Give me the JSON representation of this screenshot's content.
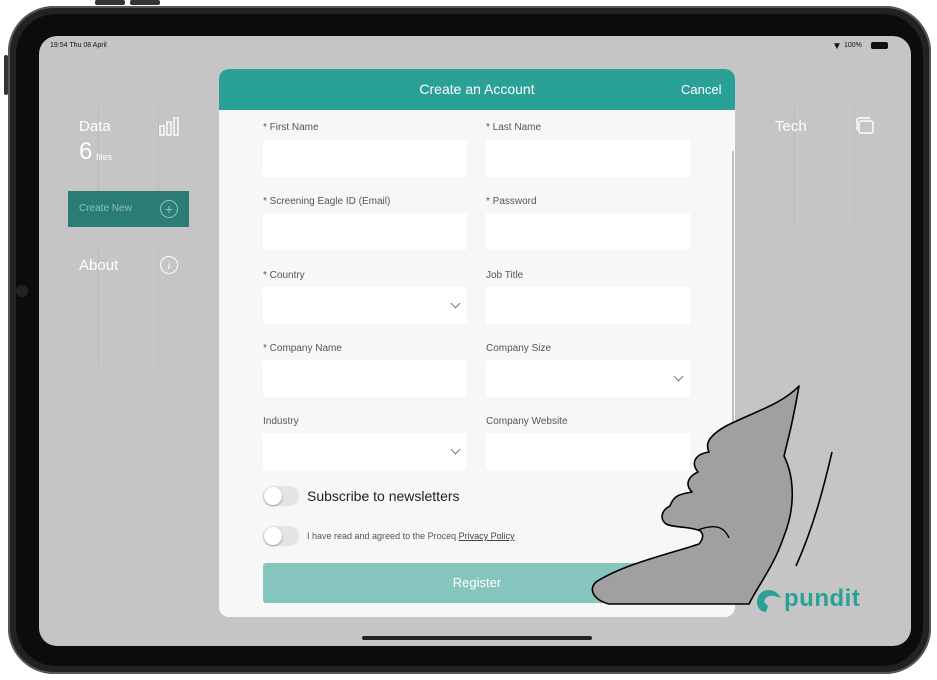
{
  "status_bar": {
    "time": "19:54 Thu 08 April",
    "battery": "100%"
  },
  "tiles": {
    "data": {
      "label": "Data",
      "count": "6",
      "count_unit": "files",
      "create_new": "Create New",
      "icon": "bar-chart-icon"
    },
    "about": {
      "label": "About",
      "icon": "info-icon"
    },
    "tech": {
      "label": "Tech",
      "icon": "tablet-icon"
    }
  },
  "modal": {
    "title": "Create an Account",
    "cancel": "Cancel",
    "fields": {
      "first_name": {
        "label": "* First Name",
        "value": ""
      },
      "last_name": {
        "label": "* Last Name",
        "value": ""
      },
      "email": {
        "label": "* Screening Eagle ID (Email)",
        "value": ""
      },
      "password": {
        "label": "* Password",
        "value": ""
      },
      "country": {
        "label": "* Country",
        "value": ""
      },
      "job_title": {
        "label": "Job Title",
        "value": ""
      },
      "company_name": {
        "label": "* Company Name",
        "value": ""
      },
      "company_size": {
        "label": "Company Size",
        "value": ""
      },
      "industry": {
        "label": "Industry",
        "value": ""
      },
      "company_website": {
        "label": "Company Website",
        "value": ""
      }
    },
    "newsletter_label": "Subscribe to newsletters",
    "newsletter_on": false,
    "privacy_prefix": "I have read and agreed to the Proceq ",
    "privacy_link": "Privacy Policy",
    "privacy_on": false,
    "register": "Register"
  },
  "brand": {
    "name": "pundit",
    "color": "#2aa197"
  },
  "colors": {
    "accent": "#2aa197",
    "tile": "#2e8d84",
    "register_disabled": "#86c4be"
  }
}
